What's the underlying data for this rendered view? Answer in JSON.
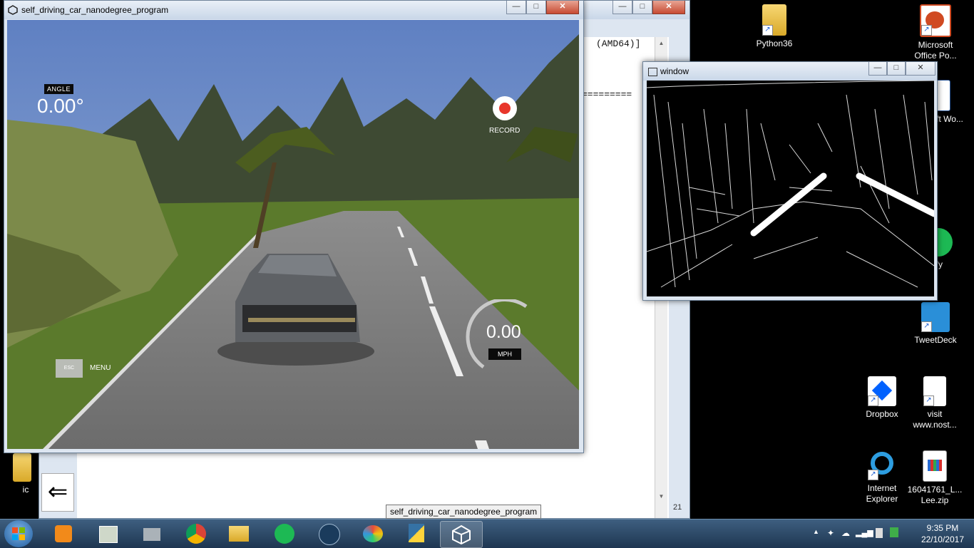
{
  "game_window": {
    "title": "self_driving_car_nanodegree_program",
    "hud": {
      "angle_label": "ANGLE",
      "angle_value": "0.00°",
      "record_label": "RECORD",
      "speed_value": "0.00",
      "speed_unit": "MPH",
      "esc_label": "ESC",
      "menu_label": "MENU"
    }
  },
  "console_window": {
    "header_text": "(AMD64)]",
    "separator": "=========",
    "line_number": "21",
    "scroll_up": "▲",
    "scroll_down": "▼"
  },
  "cv_window": {
    "title": "window"
  },
  "window_controls": {
    "minimize": "—",
    "maximize": "□",
    "close": "✕"
  },
  "desktop": {
    "icons": [
      {
        "label": "Python36",
        "icon": "folder-icon"
      },
      {
        "label": "Microsoft Office Po...",
        "icon": "powerpoint-icon"
      },
      {
        "label": "icrosoft Wo...",
        "icon": "word-icon"
      },
      {
        "label": "ify",
        "icon": "spotify-icon"
      },
      {
        "label": "TweetDeck",
        "icon": "tweetdeck-icon"
      },
      {
        "label": "Dropbox",
        "icon": "dropbox-icon"
      },
      {
        "label": "visit www.nost...",
        "icon": "file-icon"
      },
      {
        "label": "Internet Explorer",
        "icon": "ie-icon"
      },
      {
        "label": "16041761_L... Lee.zip",
        "icon": "zip-icon"
      },
      {
        "label": "ic",
        "icon": "folder-icon"
      }
    ]
  },
  "taskbar": {
    "tooltip": "self_driving_car_nanodegree_program",
    "apps": [
      "start",
      "media-player",
      "photos",
      "system",
      "chrome",
      "explorer",
      "spotify",
      "steam",
      "paint",
      "python",
      "unity"
    ],
    "clock_time": "9:35 PM",
    "clock_date": "22/10/2017"
  },
  "colors": {
    "record": "#e8362b",
    "taskbar": "#2a4763",
    "sky": "#6f8fc9"
  }
}
